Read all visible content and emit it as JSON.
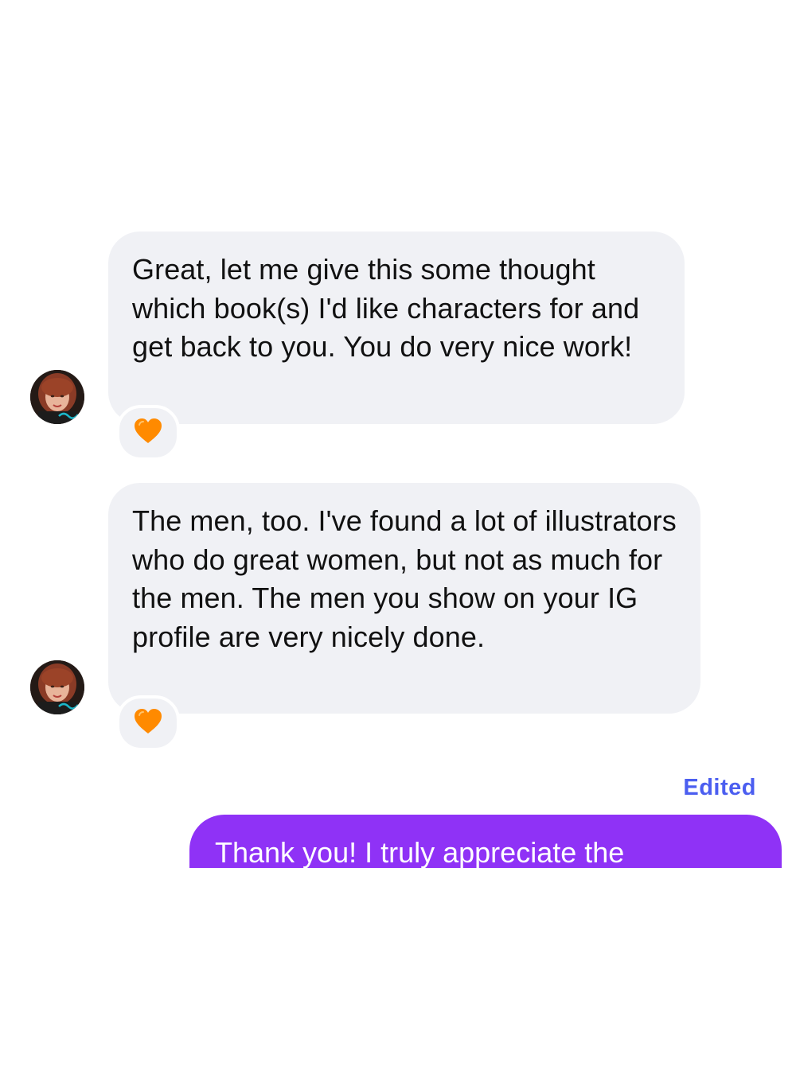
{
  "conversation": {
    "messages": [
      {
        "sender": "them",
        "text": "Great, let me give this some thought which book(s) I'd like characters for and get back to you. You do very nice work!",
        "reaction": "🧡"
      },
      {
        "sender": "them",
        "text": "The men, too. I've found a lot of illustrators who do great women, but not as much for the men. The men you show on your IG profile are very nicely done.",
        "reaction": "🧡"
      },
      {
        "sender": "me",
        "edited_label": "Edited",
        "text": "Thank you! I truly appreciate the"
      }
    ]
  },
  "colors": {
    "incoming_bubble": "#f0f1f5",
    "outgoing_bubble": "#8f32f6",
    "edited_label": "#4b5ef0",
    "reaction_heart": "#ff8a00"
  },
  "icons": {
    "avatar": "profile-photo-avatar",
    "reaction": "orange-heart-icon"
  }
}
